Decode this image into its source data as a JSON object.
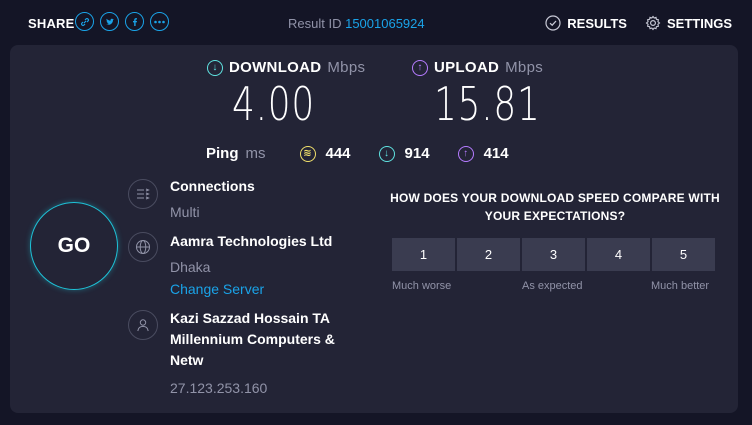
{
  "topbar": {
    "share_label": "SHARE",
    "share_icons": [
      "link-icon",
      "twitter-icon",
      "facebook-icon",
      "more-icon"
    ],
    "result_id_label": "Result ID",
    "result_id": "15001065924",
    "results_label": "RESULTS",
    "settings_label": "SETTINGS"
  },
  "download": {
    "label": "DOWNLOAD",
    "unit": "Mbps",
    "value": "4.00"
  },
  "upload": {
    "label": "UPLOAD",
    "unit": "Mbps",
    "value": "15.81"
  },
  "ping": {
    "label": "Ping",
    "unit": "ms",
    "idle": "444",
    "download": "914",
    "upload": "414"
  },
  "go_label": "GO",
  "connections": {
    "title": "Connections",
    "value": "Multi"
  },
  "server": {
    "title": "Aamra Technologies Ltd",
    "location": "Dhaka",
    "change_label": "Change Server"
  },
  "provider": {
    "title": "Kazi Sazzad Hossain TA Millennium Computers & Netw",
    "ip": "27.123.253.160"
  },
  "survey": {
    "question": "HOW DOES YOUR DOWNLOAD SPEED COMPARE WITH YOUR EXPECTATIONS?",
    "options": [
      "1",
      "2",
      "3",
      "4",
      "5"
    ],
    "low_label": "Much worse",
    "mid_label": "As expected",
    "high_label": "Much better"
  },
  "colors": {
    "background": "#141526",
    "panel": "#232436",
    "accent_blue": "#1aa3e8",
    "download_cyan": "#5fe2e0",
    "upload_purple": "#b57bff",
    "ping_yellow": "#f1e06b"
  }
}
